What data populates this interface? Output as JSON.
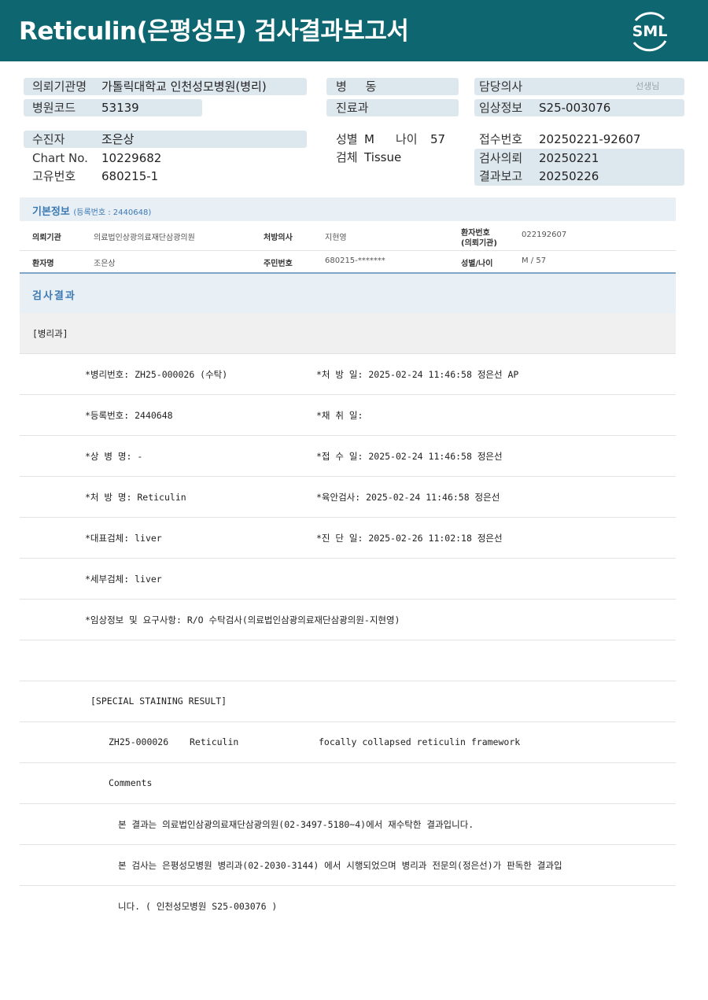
{
  "header": {
    "title": "Reticulin(은평성모) 검사결과보고서",
    "logo_text": "SML"
  },
  "info": {
    "requesting_org_label": "의뢰기관명",
    "requesting_org_value": "가톨릭대학교 인천성모병원(병리)",
    "hospital_code_label": "병원코드",
    "hospital_code_value": "53139",
    "ward_label": "병     동",
    "dept_label": "진료과",
    "doctor_label": "담당의사",
    "doctor_suffix": "선생님",
    "clinical_info_label": "임상정보",
    "clinical_info_value": "S25-003076",
    "patient_label": "수진자",
    "patient_value": "조은상",
    "chart_label": "Chart No.",
    "chart_value": "10229682",
    "unique_label": "고유번호",
    "unique_value": "680215-1",
    "sex_label": "성별",
    "sex_value": "M",
    "age_label": "나이",
    "age_value": "57",
    "specimen_label": "검체",
    "specimen_value": "Tissue",
    "receipt_label": "접수번호",
    "receipt_value": "20250221-92607",
    "request_label": "검사의뢰",
    "request_value": "20250221",
    "report_label": "결과보고",
    "report_value": "20250226"
  },
  "basic": {
    "title": "기본정보",
    "subtitle": "(등록번호 : 2440648)",
    "row1": {
      "k1": "의뢰기관",
      "v1": "의료법인상광의료재단삼광의원",
      "k2": "처방의사",
      "v2": "지현영",
      "k3a": "환자번호",
      "k3b": "(의뢰기관)",
      "v3": "022192607"
    },
    "row2": {
      "k1": "환자명",
      "v1": "조은상",
      "k2": "주민번호",
      "v2": "680215-*******",
      "k3": "성별/나이",
      "v3": "M / 57"
    }
  },
  "results": {
    "title": "검사결과",
    "dept": "[병리과]",
    "rows": [
      {
        "left": "*병리번호: ZH25-000026 (수탁)",
        "right": "*처 방 일: 2025-02-24 11:46:58  정은선 AP"
      },
      {
        "left": "*등록번호: 2440648",
        "right": "*채 취 일:"
      },
      {
        "left": "*상 병 명: -",
        "right": "*접 수 일: 2025-02-24 11:46:58  정은선"
      },
      {
        "left": "*처 방 명: Reticulin",
        "right": "*육안검사: 2025-02-24 11:46:58  정은선"
      },
      {
        "left": "*대표검체: liver",
        "right": "*진 단 일: 2025-02-26 11:02:18  정은선"
      },
      {
        "left": "*세부검체: liver",
        "right": ""
      },
      {
        "left": "*임상정보 및 요구사항: R/O 수탁검사(의료법인삼광의료재단삼광의원-지현영)",
        "right": ""
      }
    ],
    "special_title": "[SPECIAL STAINING RESULT]",
    "stain_id": "ZH25-000026",
    "stain_name": "Reticulin",
    "stain_result": "focally collapsed reticulin framework",
    "comments_label": "Comments",
    "comment1": "본 결과는 의료법인삼광의료재단삼광의원(02-3497-5180~4)에서 재수탁한 결과입니다.",
    "comment2": "본 검사는 은평성모병원 병리과(02-2030-3144) 에서 시행되었으며 병리과 전문의(정은선)가 판독한 결과입",
    "comment3": "니다. ( 인천성모병원 S25-003076 )"
  }
}
